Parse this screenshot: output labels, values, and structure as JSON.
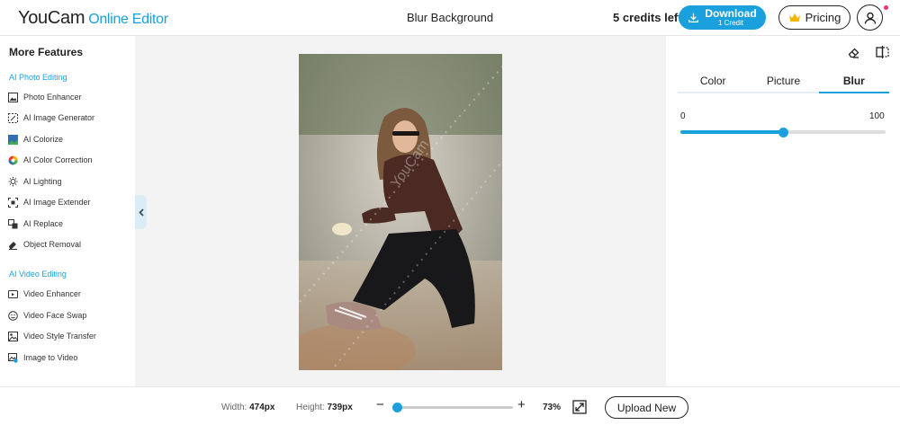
{
  "header": {
    "brand": "YouCam",
    "brand_sub": "Online Editor",
    "title": "Blur Background",
    "credits": "5 credits left",
    "download_label": "Download",
    "download_sub": "1 Credit",
    "pricing_label": "Pricing"
  },
  "sidebar": {
    "title": "More Features",
    "photo_section": "AI Photo Editing",
    "photo_items": [
      {
        "label": "Photo Enhancer",
        "icon": "image-icon"
      },
      {
        "label": "AI Image Generator",
        "icon": "wand-icon"
      },
      {
        "label": "AI Colorize",
        "icon": "colorize-icon"
      },
      {
        "label": "AI Color Correction",
        "icon": "color-wheel-icon"
      },
      {
        "label": "AI Lighting",
        "icon": "bulb-icon"
      },
      {
        "label": "AI Image Extender",
        "icon": "extend-icon"
      },
      {
        "label": "AI Replace",
        "icon": "replace-icon"
      },
      {
        "label": "Object Removal",
        "icon": "eraser-icon"
      }
    ],
    "video_section": "AI Video Editing",
    "video_items": [
      {
        "label": "Video Enhancer",
        "icon": "video-enhance-icon"
      },
      {
        "label": "Video Face Swap",
        "icon": "face-swap-icon"
      },
      {
        "label": "Video Style Transfer",
        "icon": "style-transfer-icon"
      },
      {
        "label": "Image to Video",
        "icon": "image-video-icon"
      }
    ]
  },
  "panel": {
    "tabs": [
      {
        "label": "Color",
        "active": false
      },
      {
        "label": "Picture",
        "active": false
      },
      {
        "label": "Blur",
        "active": true
      }
    ],
    "range_min": "0",
    "range_max": "100",
    "blur_value": 50
  },
  "footer": {
    "width_label": "Width:",
    "width_value": "474px",
    "height_label": "Height:",
    "height_value": "739px",
    "zoom_minus": "−",
    "zoom_plus": "+",
    "zoom_value": "73%",
    "zoom_fraction": 0.04,
    "upload_label": "Upload New"
  },
  "colors": {
    "accent": "#1aa0dc",
    "notify_dot": "#e8336b"
  }
}
